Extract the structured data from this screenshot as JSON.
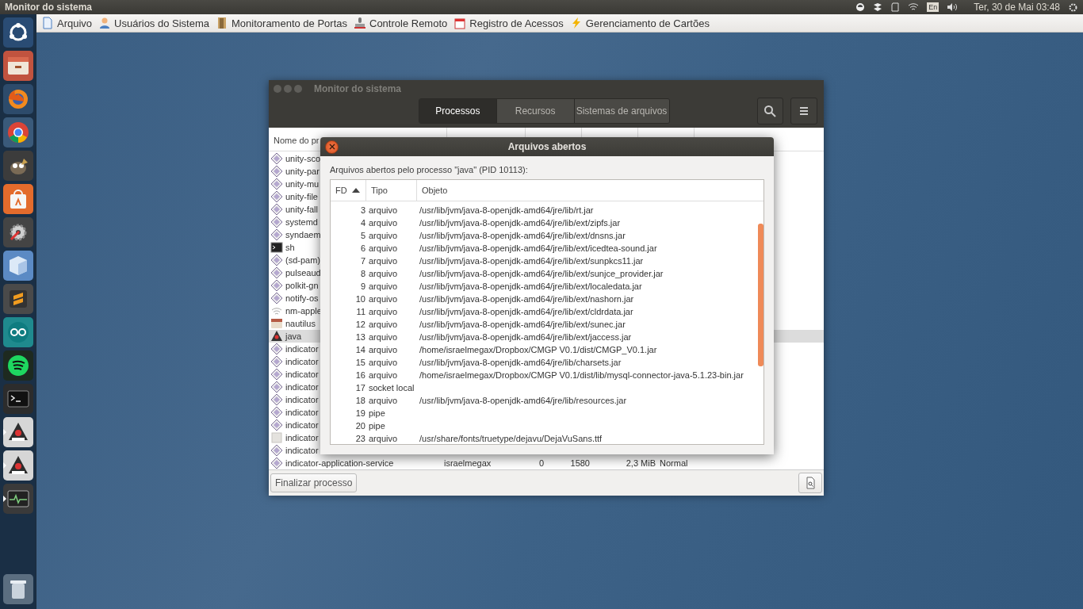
{
  "top_bar": {
    "title": "Monitor do sistema",
    "keyboard": "En",
    "clock": "Ter, 30 de Mai 03:48"
  },
  "menu_bar": {
    "items": [
      {
        "label": "Arquivo",
        "kind": "document"
      },
      {
        "label": "Usuários do Sistema",
        "kind": "user"
      },
      {
        "label": "Monitoramento de Portas",
        "kind": "door"
      },
      {
        "label": "Controle Remoto",
        "kind": "stamp"
      },
      {
        "label": "Registro de Acessos",
        "kind": "calendar"
      },
      {
        "label": "Gerenciamento de Cartões",
        "kind": "bolt"
      }
    ]
  },
  "launcher": [
    {
      "kind": "ubuntu",
      "running": false
    },
    {
      "kind": "files",
      "running": false
    },
    {
      "kind": "firefox",
      "running": false
    },
    {
      "kind": "chrome",
      "running": false
    },
    {
      "kind": "gimp",
      "running": false
    },
    {
      "kind": "software",
      "running": false
    },
    {
      "kind": "settings",
      "running": false
    },
    {
      "kind": "box",
      "running": false
    },
    {
      "kind": "sublime",
      "running": false
    },
    {
      "kind": "arduino",
      "running": false
    },
    {
      "kind": "spotify",
      "running": false
    },
    {
      "kind": "terminal",
      "running": false
    },
    {
      "kind": "java",
      "running": true
    },
    {
      "kind": "java",
      "running": true
    },
    {
      "kind": "monitor",
      "running": true
    },
    {
      "kind": "trash",
      "running": false
    }
  ],
  "monitor_window": {
    "title": "Monitor do sistema",
    "tabs": [
      {
        "label": "Processos",
        "selected": true
      },
      {
        "label": "Recursos",
        "selected": false
      },
      {
        "label": "Sistemas de arquivos",
        "selected": false
      }
    ],
    "columns": [
      "Nome do pr"
    ],
    "processes": [
      {
        "name": "unity-sco",
        "kind": "executable",
        "selected": false
      },
      {
        "name": "unity-par",
        "kind": "executable",
        "selected": false
      },
      {
        "name": "unity-mu",
        "kind": "executable",
        "selected": false
      },
      {
        "name": "unity-file",
        "kind": "executable",
        "selected": false
      },
      {
        "name": "unity-fall",
        "kind": "executable",
        "selected": false
      },
      {
        "name": "systemd",
        "kind": "executable",
        "selected": false
      },
      {
        "name": "syndaem",
        "kind": "executable",
        "selected": false
      },
      {
        "name": "sh",
        "kind": "terminal",
        "selected": false
      },
      {
        "name": "(sd-pam)",
        "kind": "executable",
        "selected": false
      },
      {
        "name": "pulseaud",
        "kind": "executable",
        "selected": false
      },
      {
        "name": "polkit-gn",
        "kind": "executable",
        "selected": false
      },
      {
        "name": "notify-os",
        "kind": "executable",
        "selected": false
      },
      {
        "name": "nm-apple",
        "kind": "wifi",
        "selected": false
      },
      {
        "name": "nautilus",
        "kind": "files",
        "selected": false
      },
      {
        "name": "java",
        "kind": "java",
        "selected": true
      },
      {
        "name": "indicator",
        "kind": "executable",
        "selected": false
      },
      {
        "name": "indicator",
        "kind": "executable",
        "selected": false
      },
      {
        "name": "indicator",
        "kind": "executable",
        "selected": false
      },
      {
        "name": "indicator",
        "kind": "executable",
        "selected": false
      },
      {
        "name": "indicator",
        "kind": "executable",
        "selected": false
      },
      {
        "name": "indicator",
        "kind": "executable",
        "selected": false
      },
      {
        "name": "indicator",
        "kind": "executable",
        "selected": false
      },
      {
        "name": "indicator",
        "kind": "card",
        "selected": false
      },
      {
        "name": "indicator",
        "kind": "executable",
        "selected": false
      },
      {
        "name": "indicator-application-service",
        "kind": "executable",
        "selected": false,
        "user": "israelmegax",
        "cpu": "0",
        "id": "1580",
        "memory": "2,3 MiB",
        "priority": "Normal"
      }
    ],
    "end_button": "Finalizar processo"
  },
  "dialog": {
    "title": "Arquivos abertos",
    "caption": "Arquivos abertos pelo processo \"java\" (PID 10113):",
    "columns": [
      {
        "label": "FD",
        "sorted": true
      },
      {
        "label": "Tipo",
        "sorted": false
      },
      {
        "label": "Objeto",
        "sorted": false
      }
    ],
    "rows": [
      {
        "fd": "3",
        "type": "arquivo",
        "object": "/usr/lib/jvm/java-8-openjdk-amd64/jre/lib/rt.jar"
      },
      {
        "fd": "4",
        "type": "arquivo",
        "object": "/usr/lib/jvm/java-8-openjdk-amd64/jre/lib/ext/zipfs.jar"
      },
      {
        "fd": "5",
        "type": "arquivo",
        "object": "/usr/lib/jvm/java-8-openjdk-amd64/jre/lib/ext/dnsns.jar"
      },
      {
        "fd": "6",
        "type": "arquivo",
        "object": "/usr/lib/jvm/java-8-openjdk-amd64/jre/lib/ext/icedtea-sound.jar"
      },
      {
        "fd": "7",
        "type": "arquivo",
        "object": "/usr/lib/jvm/java-8-openjdk-amd64/jre/lib/ext/sunpkcs11.jar"
      },
      {
        "fd": "8",
        "type": "arquivo",
        "object": "/usr/lib/jvm/java-8-openjdk-amd64/jre/lib/ext/sunjce_provider.jar"
      },
      {
        "fd": "9",
        "type": "arquivo",
        "object": "/usr/lib/jvm/java-8-openjdk-amd64/jre/lib/ext/localedata.jar"
      },
      {
        "fd": "10",
        "type": "arquivo",
        "object": "/usr/lib/jvm/java-8-openjdk-amd64/jre/lib/ext/nashorn.jar"
      },
      {
        "fd": "11",
        "type": "arquivo",
        "object": "/usr/lib/jvm/java-8-openjdk-amd64/jre/lib/ext/cldrdata.jar"
      },
      {
        "fd": "12",
        "type": "arquivo",
        "object": "/usr/lib/jvm/java-8-openjdk-amd64/jre/lib/ext/sunec.jar"
      },
      {
        "fd": "13",
        "type": "arquivo",
        "object": "/usr/lib/jvm/java-8-openjdk-amd64/jre/lib/ext/jaccess.jar"
      },
      {
        "fd": "14",
        "type": "arquivo",
        "object": "/home/israelmegax/Dropbox/CMGP V0.1/dist/CMGP_V0.1.jar"
      },
      {
        "fd": "15",
        "type": "arquivo",
        "object": "/usr/lib/jvm/java-8-openjdk-amd64/jre/lib/charsets.jar"
      },
      {
        "fd": "16",
        "type": "arquivo",
        "object": "/home/israelmegax/Dropbox/CMGP V0.1/dist/lib/mysql-connector-java-5.1.23-bin.jar"
      },
      {
        "fd": "17",
        "type": "socket local"
      },
      {
        "fd": "18",
        "type": "arquivo",
        "object": "/usr/lib/jvm/java-8-openjdk-amd64/jre/lib/resources.jar"
      },
      {
        "fd": "19",
        "type": "pipe"
      },
      {
        "fd": "20",
        "type": "pipe"
      },
      {
        "fd": "23",
        "type": "arquivo",
        "object": "/usr/share/fonts/truetype/dejavu/DejaVuSans.ttf"
      }
    ]
  }
}
